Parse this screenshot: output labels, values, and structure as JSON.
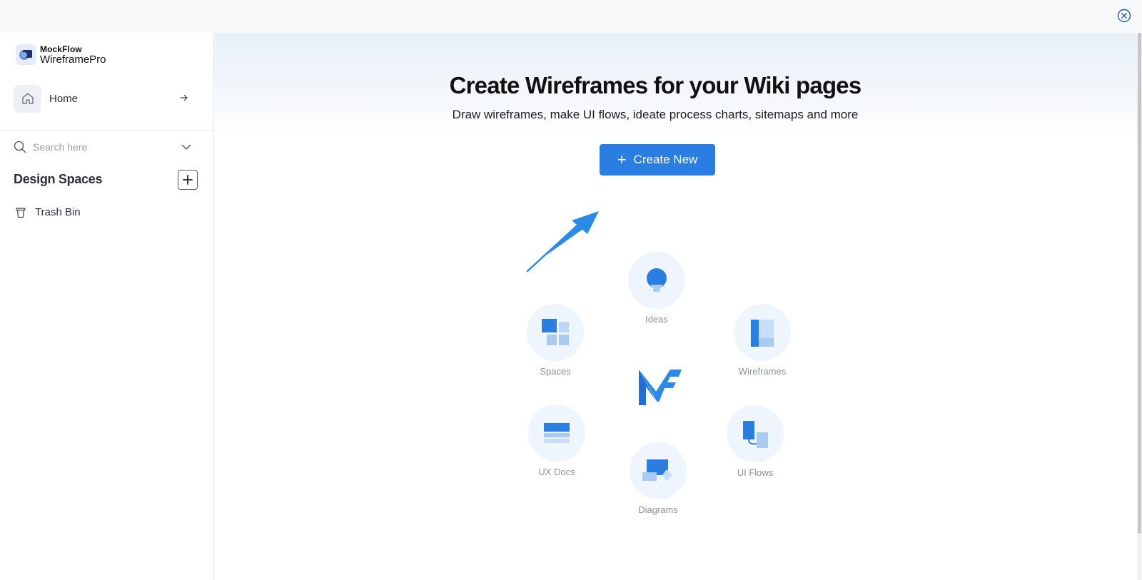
{
  "app": {
    "brand": "MockFlow",
    "product": "WireframePro"
  },
  "sidebar": {
    "home_label": "Home",
    "search_placeholder": "Search here",
    "spaces_title": "Design Spaces",
    "trash_label": "Trash Bin"
  },
  "main": {
    "headline": "Create Wireframes for your Wiki pages",
    "subline": "Draw wireframes, make UI flows, ideate process charts, sitemaps and more",
    "create_button": "Create New",
    "features": {
      "ideas": "Ideas",
      "spaces": "Spaces",
      "wireframes": "Wireframes",
      "ux_docs": "UX Docs",
      "ui_flows": "UI Flows",
      "diagrams": "Diagrams"
    }
  },
  "icons": {
    "close": "close-circle-icon",
    "home": "home-icon",
    "arrow": "arrow-right-icon",
    "search": "search-icon",
    "chevron": "chevron-down-icon",
    "add": "plus-icon",
    "trash": "trash-icon"
  },
  "colors": {
    "accent": "#2a7de1",
    "feature_bg": "#eef5fd",
    "icon_dark": "#2a7de1",
    "icon_light": "#a9cbf2"
  }
}
